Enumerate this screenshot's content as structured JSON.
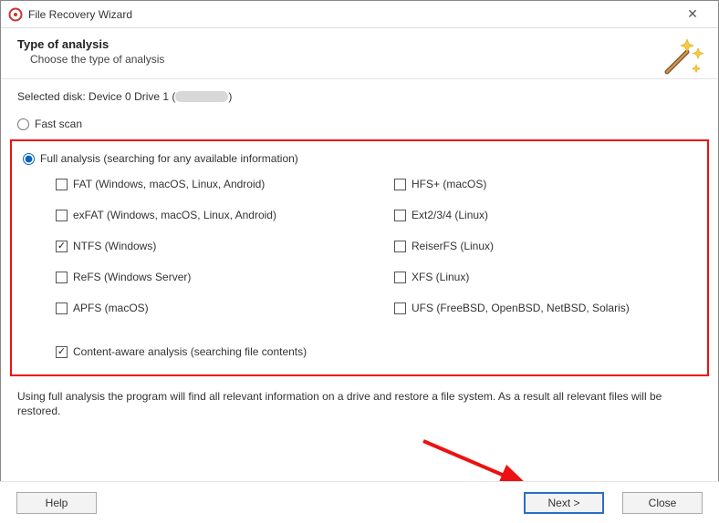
{
  "window": {
    "title": "File Recovery Wizard"
  },
  "header": {
    "title": "Type of analysis",
    "subtitle": "Choose the type of analysis"
  },
  "disk": {
    "label_prefix": "Selected disk: ",
    "label_value": "Device 0 Drive 1 (",
    "label_suffix": ")"
  },
  "radios": {
    "fast": "Fast scan",
    "full": "Full analysis (searching for any available information)"
  },
  "selected_radio": "full",
  "content_aware": {
    "label": "Content-aware analysis (searching file contents)",
    "checked": true
  },
  "filesystems_left": [
    {
      "key": "fat",
      "label": "FAT (Windows, macOS, Linux, Android)",
      "checked": false
    },
    {
      "key": "exfat",
      "label": "exFAT (Windows, macOS, Linux, Android)",
      "checked": false
    },
    {
      "key": "ntfs",
      "label": "NTFS (Windows)",
      "checked": true
    },
    {
      "key": "refs",
      "label": "ReFS (Windows Server)",
      "checked": false
    },
    {
      "key": "apfs",
      "label": "APFS (macOS)",
      "checked": false
    }
  ],
  "filesystems_right": [
    {
      "key": "hfs",
      "label": "HFS+ (macOS)",
      "checked": false
    },
    {
      "key": "ext",
      "label": "Ext2/3/4 (Linux)",
      "checked": false
    },
    {
      "key": "reiser",
      "label": "ReiserFS (Linux)",
      "checked": false
    },
    {
      "key": "xfs",
      "label": "XFS (Linux)",
      "checked": false
    },
    {
      "key": "ufs",
      "label": "UFS (FreeBSD, OpenBSD, NetBSD, Solaris)",
      "checked": false
    }
  ],
  "description": "Using full analysis the program will find all relevant information on a drive and restore a file system. As a result all relevant files will be restored.",
  "buttons": {
    "help": "Help",
    "next": "Next >",
    "close": "Close"
  }
}
